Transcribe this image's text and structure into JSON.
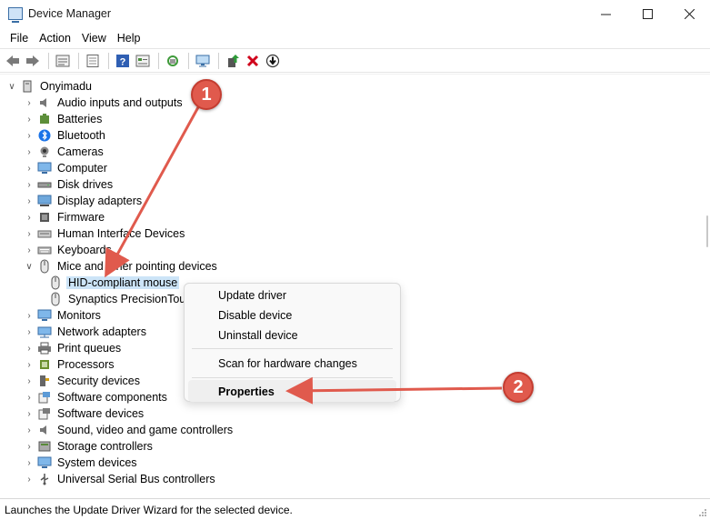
{
  "window": {
    "title": "Device Manager"
  },
  "menu": [
    "File",
    "Action",
    "View",
    "Help"
  ],
  "tree": {
    "root": "Onyimadu",
    "categories": [
      "Audio inputs and outputs",
      "Batteries",
      "Bluetooth",
      "Cameras",
      "Computer",
      "Disk drives",
      "Display adapters",
      "Firmware",
      "Human Interface Devices",
      "Keyboards",
      "Mice and other pointing devices",
      "HID-compliant mouse",
      "Synaptics PrecisionTouchPad",
      "Monitors",
      "Network adapters",
      "Print queues",
      "Processors",
      "Security devices",
      "Software components",
      "Software devices",
      "Sound, video and game controllers",
      "Storage controllers",
      "System devices",
      "Universal Serial Bus controllers"
    ]
  },
  "context_menu": {
    "update": "Update driver",
    "disable": "Disable device",
    "uninstall": "Uninstall device",
    "scan": "Scan for hardware changes",
    "properties": "Properties"
  },
  "status": "Launches the Update Driver Wizard for the selected device.",
  "annotations": {
    "one": "1",
    "two": "2",
    "color": "#e05a4d"
  }
}
